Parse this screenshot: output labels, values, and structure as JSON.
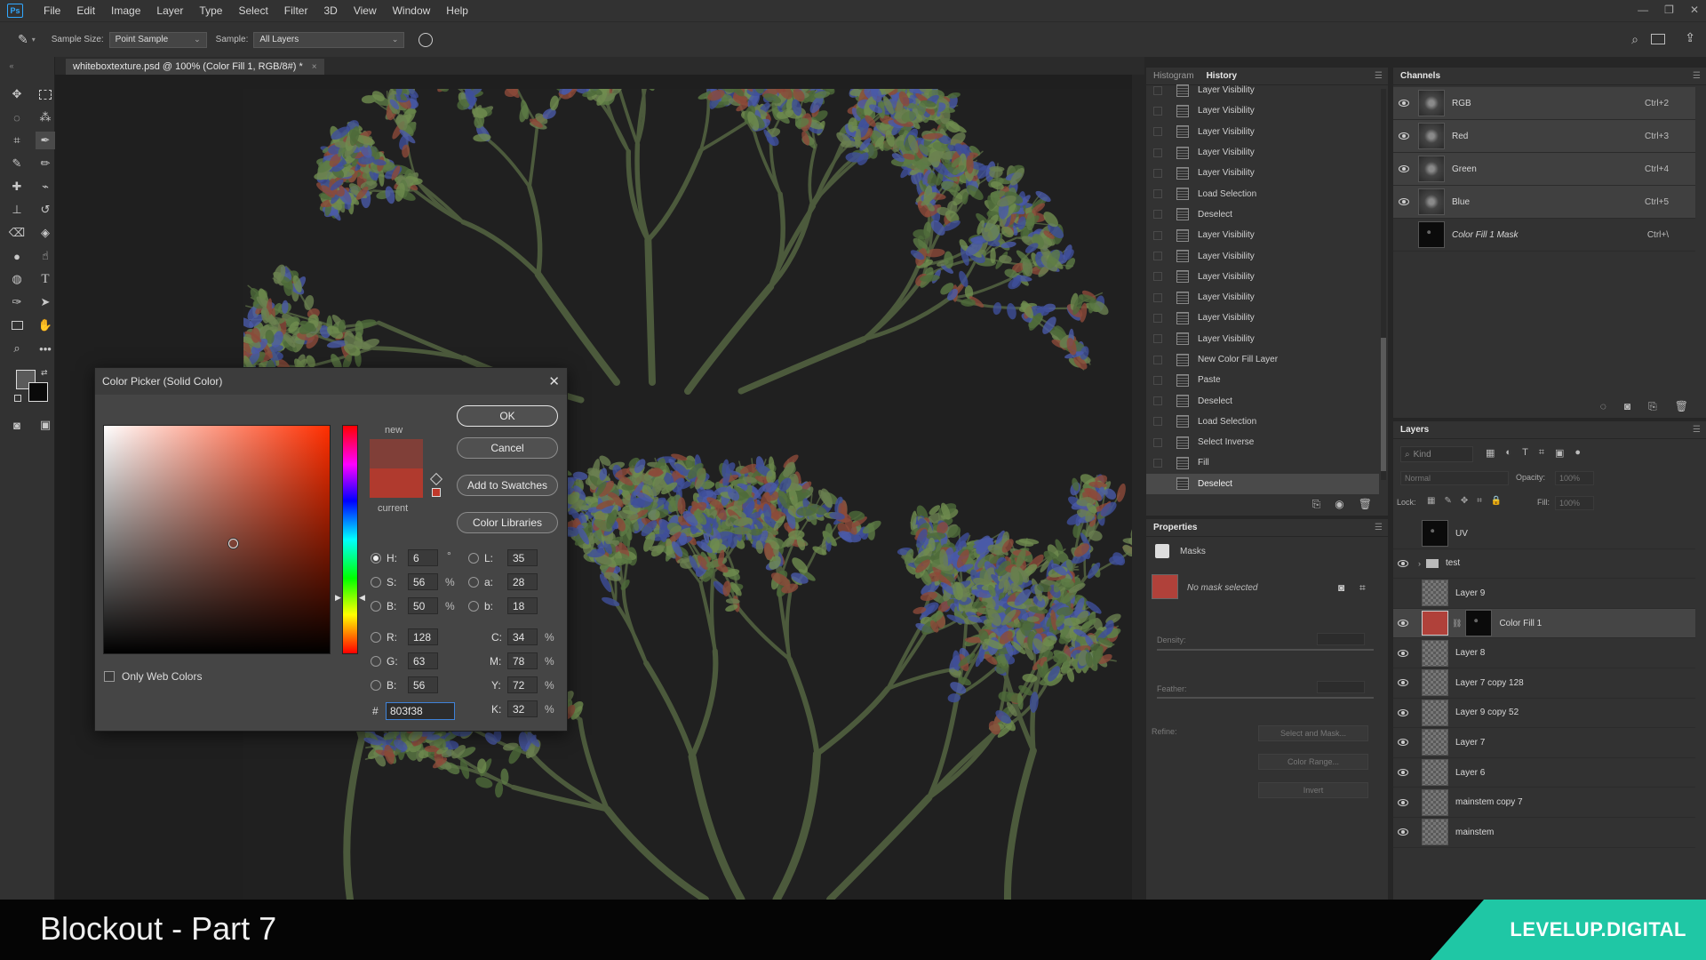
{
  "menu": {
    "logo": "Ps",
    "items": [
      "File",
      "Edit",
      "Image",
      "Layer",
      "Type",
      "Select",
      "Filter",
      "3D",
      "View",
      "Window",
      "Help"
    ]
  },
  "options": {
    "sample_size_label": "Sample Size:",
    "sample_size_value": "Point Sample",
    "sample_label": "Sample:",
    "sample_value": "All Layers"
  },
  "document": {
    "tab_title": "whiteboxtexture.psd @ 100% (Color Fill 1, RGB/8#) *",
    "close": "×"
  },
  "history": {
    "tabs": [
      "Histogram",
      "History"
    ],
    "items": [
      "Layer Visibility",
      "Layer Visibility",
      "Layer Visibility",
      "Layer Visibility",
      "Layer Visibility",
      "Load Selection",
      "Deselect",
      "Layer Visibility",
      "Layer Visibility",
      "Layer Visibility",
      "Layer Visibility",
      "Layer Visibility",
      "Layer Visibility",
      "New Color Fill Layer",
      "Paste",
      "Deselect",
      "Load Selection",
      "Select Inverse",
      "Fill",
      "Deselect"
    ],
    "selected_index": 19
  },
  "channels": {
    "tab": "Channels",
    "items": [
      {
        "name": "RGB",
        "shortcut": "Ctrl+2"
      },
      {
        "name": "Red",
        "shortcut": "Ctrl+3"
      },
      {
        "name": "Green",
        "shortcut": "Ctrl+4"
      },
      {
        "name": "Blue",
        "shortcut": "Ctrl+5"
      },
      {
        "name": "Color Fill 1 Mask",
        "shortcut": "Ctrl+\\"
      }
    ]
  },
  "properties": {
    "tab": "Properties",
    "masks_label": "Masks",
    "no_mask": "No mask selected",
    "density_label": "Density:",
    "feather_label": "Feather:",
    "refine_label": "Refine:",
    "select_and_mask": "Select and Mask...",
    "color_range": "Color Range...",
    "invert": "Invert"
  },
  "layers": {
    "tab": "Layers",
    "kind_placeholder": "Kind",
    "blend_mode": "Normal",
    "opacity_label": "Opacity:",
    "opacity_value": "100%",
    "lock_label": "Lock:",
    "fill_label": "Fill:",
    "fill_value": "100%",
    "items": [
      "UV",
      "test",
      "Layer 9",
      "Color Fill 1",
      "Layer 8",
      "Layer 7 copy 128",
      "Layer 9 copy 52",
      "Layer 7",
      "Layer 6",
      "mainstem copy 7",
      "mainstem"
    ]
  },
  "color_picker": {
    "title": "Color Picker (Solid Color)",
    "close": "✕",
    "new_label": "new",
    "current_label": "current",
    "ok": "OK",
    "cancel": "Cancel",
    "add_to_swatches": "Add to Swatches",
    "color_libraries": "Color Libraries",
    "only_web_colors": "Only Web Colors",
    "H": "6",
    "S": "56",
    "B": "50",
    "R": "128",
    "G": "63",
    "Bv": "56",
    "L": "35",
    "a": "28",
    "b": "18",
    "C": "34",
    "M": "78",
    "Y": "72",
    "K": "32",
    "hex": "803f38",
    "new_color": "#803f38",
    "current_color": "#b03a2e"
  },
  "banner": {
    "title": "Blockout - Part 7",
    "brand": "LEVELUP.DIGITAL"
  }
}
